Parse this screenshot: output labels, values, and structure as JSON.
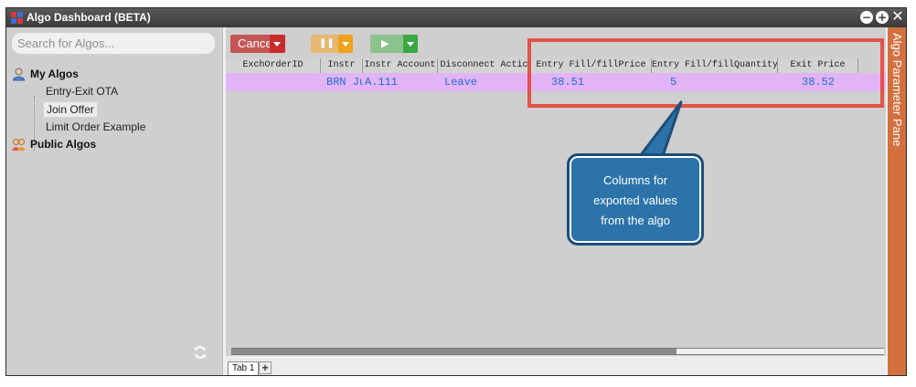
{
  "window": {
    "title": "Algo Dashboard (BETA)"
  },
  "window_controls": {
    "minimize": "−",
    "maximize": "+",
    "close": "✕"
  },
  "search": {
    "placeholder": "Search for Algos..."
  },
  "tree": {
    "my_algos": {
      "label": "My Algos",
      "items": [
        {
          "label": "Entry-Exit OTA"
        },
        {
          "label": "Join Offer"
        },
        {
          "label": "Limit Order Example"
        }
      ]
    },
    "public_algos": {
      "label": "Public Algos"
    }
  },
  "toolbar": {
    "cancel_label": "Cancel",
    "pause_glyph": "❚❚",
    "play_glyph": "▶"
  },
  "grid": {
    "columns": [
      "ExchOrderID",
      "Instr",
      "Instr Account",
      "Disconnect Actic",
      "Entry Fill/fillPrice",
      "Entry Fill/fillQuantity",
      "Exit Price"
    ],
    "row": [
      "",
      "BRN Jul",
      "A.111",
      "Leave",
      "38.51",
      "5",
      "38.52"
    ]
  },
  "tabs": [
    {
      "label": "Tab 1"
    }
  ],
  "tab_add": "+",
  "right_pane": {
    "label": "Algo Parameter Pane"
  },
  "annotation": {
    "lines": [
      "Columns for",
      "exported values",
      "from the algo"
    ]
  },
  "colors": {
    "highlight": "#e3524b",
    "callout": "#2b73a8",
    "row": "#e2b4f5",
    "cell_text": "#1d6edb",
    "right_pane": "#d3703f"
  }
}
